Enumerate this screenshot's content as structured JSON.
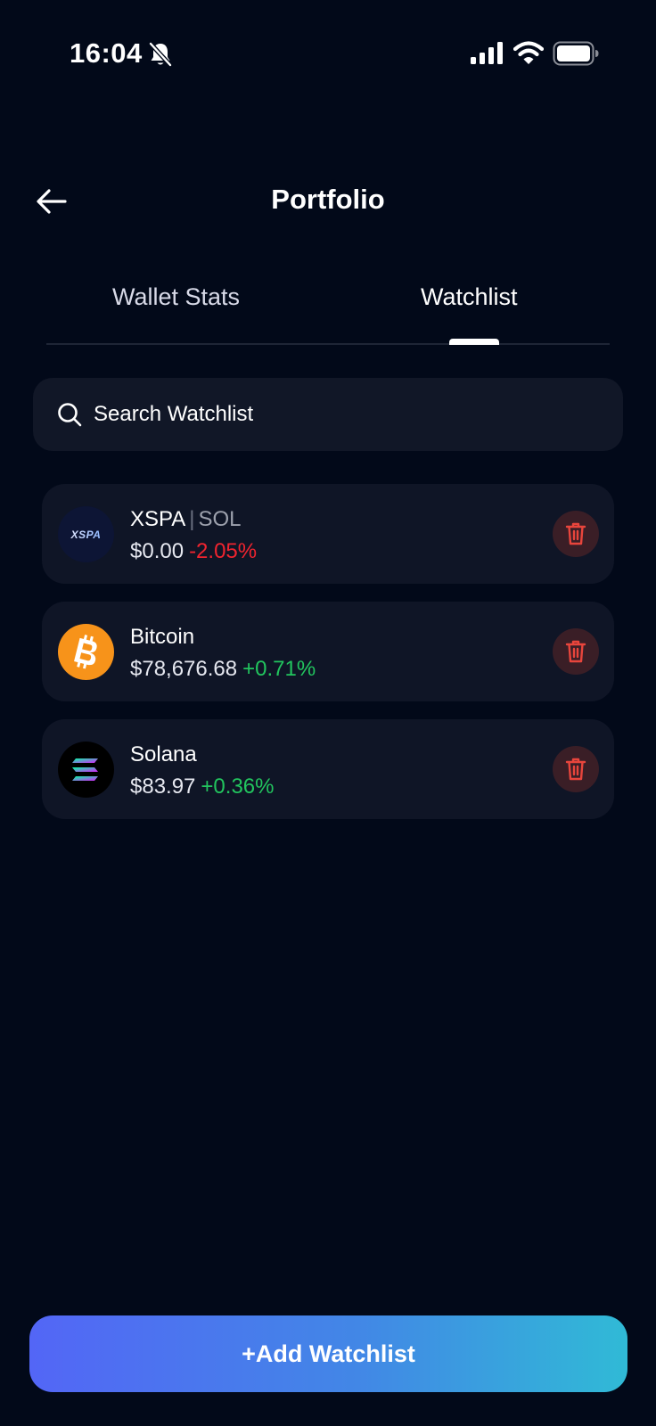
{
  "status_bar": {
    "time": "16:04"
  },
  "header": {
    "title": "Portfolio"
  },
  "tabs": [
    {
      "label": "Wallet Stats",
      "active": false
    },
    {
      "label": "Watchlist",
      "active": true
    }
  ],
  "search": {
    "placeholder": "Search Watchlist",
    "value": ""
  },
  "watchlist": [
    {
      "name": "XSPA",
      "chain": "SOL",
      "price": "$0.00",
      "change": "-2.05%",
      "direction": "down",
      "logo_text": "XSPA",
      "icon": "xspa-logo"
    },
    {
      "name": "Bitcoin",
      "chain": "",
      "price": "$78,676.68",
      "change": "+0.71%",
      "direction": "up",
      "icon": "bitcoin-logo"
    },
    {
      "name": "Solana",
      "chain": "",
      "price": "$83.97",
      "change": "+0.36%",
      "direction": "up",
      "icon": "solana-logo"
    }
  ],
  "add_button": {
    "label": "+Add Watchlist"
  },
  "colors": {
    "background": "#020919",
    "card": "#0f1526",
    "negative": "#f0242f",
    "positive": "#22c55e",
    "delete": "#e8453c",
    "gradient_start": "#5366f6",
    "gradient_end": "#30bad6",
    "bitcoin": "#f7931a"
  }
}
